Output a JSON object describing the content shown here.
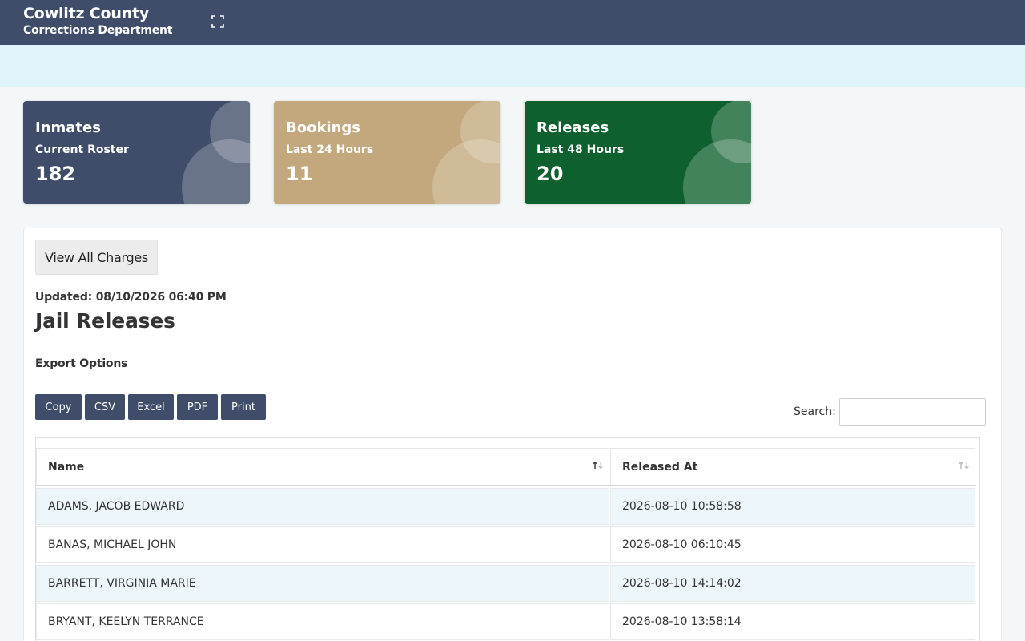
{
  "header": {
    "county": "Cowlitz County",
    "department": "Corrections Department",
    "fullscreen_icon": "fullscreen-icon"
  },
  "cards": [
    {
      "title": "Inmates",
      "subtitle": "Current Roster",
      "value": "182",
      "color": "#3f4d6a"
    },
    {
      "title": "Bookings",
      "subtitle": "Last 24 Hours",
      "value": "11",
      "color": "#c2a87c"
    },
    {
      "title": "Releases",
      "subtitle": "Last 48 Hours",
      "value": "20",
      "color": "#0f602f"
    }
  ],
  "main": {
    "view_charges_label": "View All Charges",
    "updated": "Updated: 08/10/2026 06:40 PM",
    "title": "Jail Releases",
    "export_label": "Export Options",
    "export_buttons": [
      "Copy",
      "CSV",
      "Excel",
      "PDF",
      "Print"
    ],
    "search_label": "Search:",
    "search_value": ""
  },
  "table": {
    "columns": [
      "Name",
      "Released At"
    ],
    "sort_icons": [
      "sort-ascending-icon",
      "sort-both-icon"
    ],
    "rows": [
      [
        "ADAMS, JACOB EDWARD",
        "2026-08-10 10:58:58"
      ],
      [
        "BANAS, MICHAEL JOHN",
        "2026-08-10 06:10:45"
      ],
      [
        "BARRETT, VIRGINIA MARIE",
        "2026-08-10 14:14:02"
      ],
      [
        "BRYANT, KEELYN TERRANCE",
        "2026-08-10 13:58:14"
      ]
    ]
  }
}
